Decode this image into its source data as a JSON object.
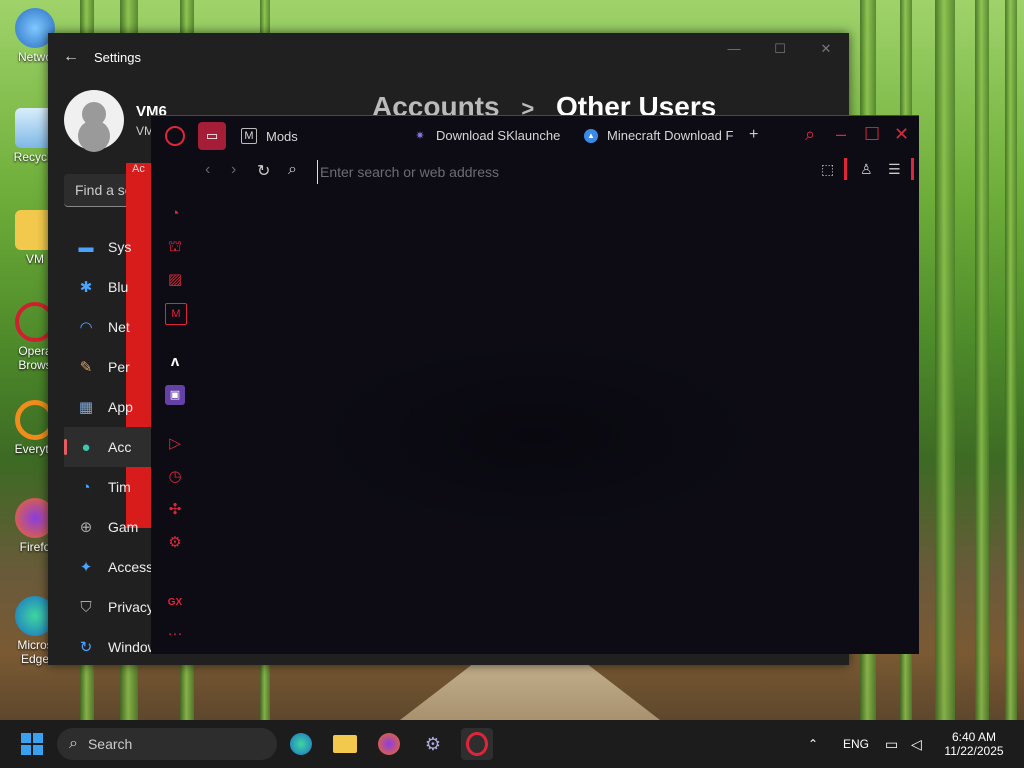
{
  "desktop": {
    "icons": [
      {
        "label": "Netwo",
        "icon": "globe-icon"
      },
      {
        "label": "Recycle",
        "icon": "recycle-bin-icon"
      },
      {
        "label": "VM",
        "icon": "folder-icon"
      },
      {
        "label": "Opera Brows",
        "icon": "opera-icon"
      },
      {
        "label": "Everyth",
        "icon": "everything-search-icon"
      },
      {
        "label": "Firefo",
        "icon": "firefox-icon"
      },
      {
        "label": "Micros Edge",
        "icon": "edge-icon"
      }
    ]
  },
  "settings": {
    "title": "Settings",
    "user_name": "VM6",
    "user_sub": "VM",
    "breadcrumb_parent": "Accounts",
    "breadcrumb_sep": ">",
    "breadcrumb_current": "Other Users",
    "search_placeholder": "Find a se",
    "strip_label": "Ac",
    "nav": [
      {
        "label": "Sys",
        "icon": "system-icon"
      },
      {
        "label": "Blu",
        "icon": "bluetooth-icon"
      },
      {
        "label": "Net",
        "icon": "wifi-icon"
      },
      {
        "label": "Per",
        "icon": "brush-icon"
      },
      {
        "label": "App",
        "icon": "apps-icon"
      },
      {
        "label": "Acc",
        "icon": "account-icon",
        "active": true
      },
      {
        "label": "Tim",
        "icon": "clock-globe-icon"
      },
      {
        "label": "Gam",
        "icon": "gamepad-icon"
      },
      {
        "label": "Accessi",
        "icon": "accessibility-icon"
      },
      {
        "label": "Privacy",
        "icon": "shield-icon"
      },
      {
        "label": "Window",
        "icon": "update-icon"
      }
    ],
    "window_controls": {
      "minimize": "—",
      "maximize": "☐",
      "close": "✕"
    }
  },
  "opera": {
    "tabs": [
      {
        "label": "Mods",
        "icon": "mods-icon"
      },
      {
        "label": "Download SKlaunche",
        "icon": "sklauncher-icon"
      },
      {
        "label": "Minecraft Download F",
        "icon": "minecraft-icon"
      }
    ],
    "new_tab": "+",
    "address_placeholder": "Enter search or web address",
    "sidebar": [
      "speed-dial-icon",
      "gx-corner-icon",
      "hot-tab-icon",
      "mods-sidebar-icon",
      "affinity-icon",
      "twitch-icon",
      "player-icon",
      "history-icon",
      "extensions-icon",
      "settings-icon",
      "gx-logo-icon",
      "more-icon"
    ],
    "gx_label": "GX",
    "more_label": "···",
    "accent": "#e0243a"
  },
  "taskbar": {
    "search_label": "Search",
    "apps": [
      "windows-start-icon",
      "edge-icon",
      "file-explorer-icon",
      "firefox-icon",
      "settings-icon",
      "opera-gx-icon"
    ],
    "tray": {
      "language": "ENG",
      "time": "6:40 AM",
      "date": "11/22/2025"
    }
  }
}
